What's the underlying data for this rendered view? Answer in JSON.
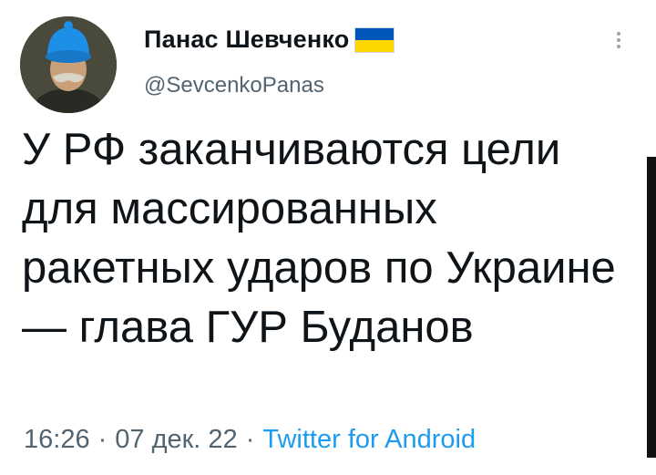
{
  "author": {
    "name": "Панас Шевченко",
    "handle": "@SevcenkoPanas",
    "flag_colors": [
      "#0057b7",
      "#ffd700"
    ]
  },
  "tweet": {
    "text": "У РФ заканчиваются цели для массированных ракетных ударов по Украине — глава ГУР Буданов",
    "time": "16:26",
    "date": "07 дек. 22",
    "source": "Twitter for Android",
    "separator": "·"
  },
  "icons": {
    "more": "more-vertical-icon",
    "avatar": "portrait-avatar"
  }
}
